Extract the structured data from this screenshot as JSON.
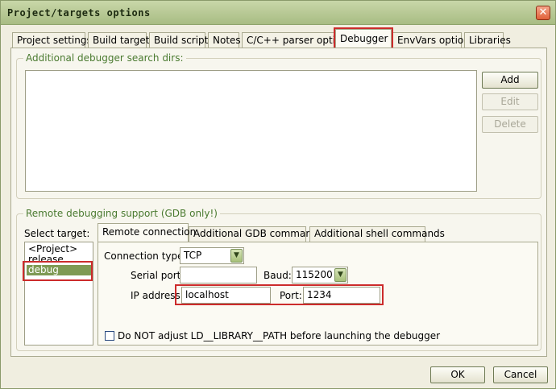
{
  "window": {
    "title": "Project/targets options",
    "close_glyph": "✕"
  },
  "tabs": [
    "Project settings",
    "Build targets",
    "Build scripts",
    "Notes",
    "C/C++ parser options",
    "Debugger",
    "EnvVars options",
    "Libraries"
  ],
  "active_tab": "Debugger",
  "search_dirs": {
    "legend": "Additional debugger search dirs:",
    "items": [],
    "add_label": "Add",
    "edit_label": "Edit",
    "delete_label": "Delete"
  },
  "remote": {
    "legend": "Remote debugging support (GDB only!)",
    "select_target_label": "Select target:",
    "targets": [
      "<Project>",
      "release",
      "debug"
    ],
    "selected_target": "debug",
    "subtabs": [
      "Remote connection",
      "Additional GDB commands",
      "Additional shell commands"
    ],
    "active_subtab": "Remote connection",
    "connection_type_label": "Connection type:",
    "connection_type_value": "TCP",
    "serial_port_label": "Serial port:",
    "serial_port_value": "",
    "baud_label": "Baud:",
    "baud_value": "115200",
    "ip_label": "IP address:",
    "ip_value": "localhost",
    "port_label": "Port:",
    "port_value": "1234",
    "ld_checkbox_label": "Do NOT adjust LD__LIBRARY__PATH before launching the debugger",
    "ld_checkbox_checked": false
  },
  "footer": {
    "ok_label": "OK",
    "cancel_label": "Cancel"
  },
  "colors": {
    "highlight_box": "#cc2b2b",
    "legend_text": "#4a7a30",
    "selection": "#7f9a54"
  }
}
